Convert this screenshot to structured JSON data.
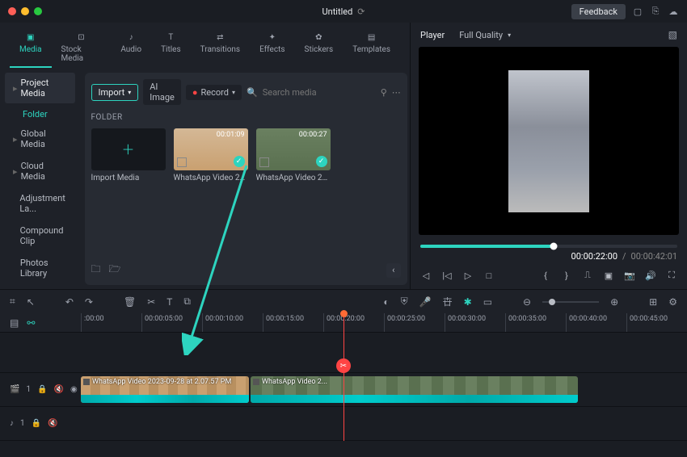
{
  "titlebar": {
    "title": "Untitled",
    "feedback": "Feedback"
  },
  "tabs": [
    {
      "label": "Media",
      "active": true
    },
    {
      "label": "Stock Media"
    },
    {
      "label": "Audio"
    },
    {
      "label": "Titles"
    },
    {
      "label": "Transitions"
    },
    {
      "label": "Effects"
    },
    {
      "label": "Stickers"
    },
    {
      "label": "Templates"
    }
  ],
  "sidebar": {
    "items": [
      {
        "label": "Project Media",
        "selected": true
      },
      {
        "label": "Global Media"
      },
      {
        "label": "Cloud Media"
      },
      {
        "label": "Adjustment La..."
      },
      {
        "label": "Compound Clip"
      },
      {
        "label": "Photos Library"
      }
    ],
    "sub": "Folder"
  },
  "toolbar": {
    "import": "Import",
    "ai_image": "AI Image",
    "record": "Record",
    "search_placeholder": "Search media"
  },
  "folder_label": "FOLDER",
  "media": {
    "import_folder": "Import Media",
    "items": [
      {
        "name": "WhatsApp Video 202...",
        "duration": "00:01:09"
      },
      {
        "name": "WhatsApp Video 202...",
        "duration": "00:00:27"
      }
    ]
  },
  "player": {
    "label": "Player",
    "quality": "Full Quality",
    "current_time": "00:00:22:00",
    "separator": "/",
    "total_time": "00:00:42:01",
    "progress_pct": 52
  },
  "ruler": [
    ":00:00",
    "00:00:05:00",
    "00:00:10:00",
    "00:00:15:00",
    "00:00:20:00",
    "00:00:25:00",
    "00:00:30:00",
    "00:00:35:00",
    "00:00:40:00",
    "00:00:45:00"
  ],
  "tracks": {
    "video_label": "1",
    "audio_label": "1",
    "clip1_label": "WhatsApp Video 2023-09-28 at 2.07.57 PM",
    "clip2_label": "WhatsApp Video 2..."
  }
}
